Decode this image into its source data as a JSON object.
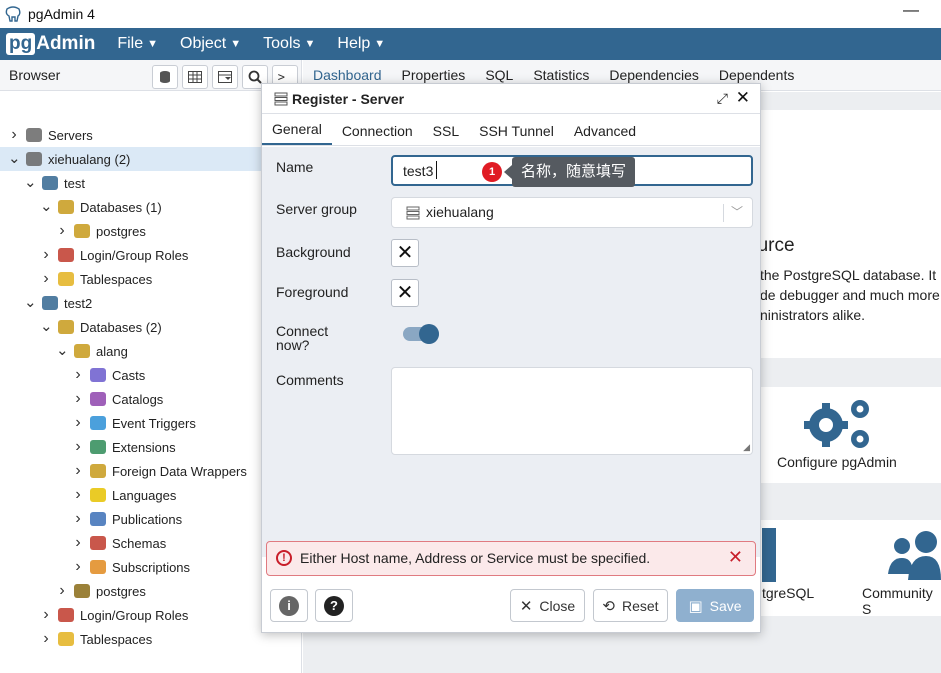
{
  "window": {
    "title": "pgAdmin 4",
    "minimize_glyph": "—"
  },
  "menubar": {
    "logo_pg": "pg",
    "logo_admin": "Admin",
    "items": [
      {
        "label": "File"
      },
      {
        "label": "Object"
      },
      {
        "label": "Tools"
      },
      {
        "label": "Help"
      }
    ]
  },
  "browser": {
    "title": "Browser",
    "tree": [
      {
        "label": "Servers",
        "icon": "servers-icon",
        "expanded": false
      },
      {
        "label": "xiehualang (2)",
        "icon": "server-group-icon",
        "expanded": true,
        "selected": true
      },
      {
        "label": "test",
        "icon": "postgres-server-icon",
        "expanded": true
      },
      {
        "label": "Databases (1)",
        "icon": "databases-icon",
        "expanded": true
      },
      {
        "label": "postgres",
        "icon": "database-icon",
        "expanded": false
      },
      {
        "label": "Login/Group Roles",
        "icon": "roles-icon",
        "expanded": false
      },
      {
        "label": "Tablespaces",
        "icon": "tablespaces-icon",
        "expanded": false
      },
      {
        "label": "test2",
        "icon": "postgres-server-icon",
        "expanded": true
      },
      {
        "label": "Databases (2)",
        "icon": "databases-icon",
        "expanded": true
      },
      {
        "label": "alang",
        "icon": "database-icon",
        "expanded": true
      },
      {
        "label": "Casts",
        "icon": "casts-icon",
        "expanded": false
      },
      {
        "label": "Catalogs",
        "icon": "catalogs-icon",
        "expanded": false
      },
      {
        "label": "Event Triggers",
        "icon": "event-triggers-icon",
        "expanded": false
      },
      {
        "label": "Extensions",
        "icon": "extensions-icon",
        "expanded": false
      },
      {
        "label": "Foreign Data Wrappers",
        "icon": "fdw-icon",
        "expanded": false
      },
      {
        "label": "Languages",
        "icon": "languages-icon",
        "expanded": false
      },
      {
        "label": "Publications",
        "icon": "publications-icon",
        "expanded": false
      },
      {
        "label": "Schemas",
        "icon": "schemas-icon",
        "expanded": false
      },
      {
        "label": "Subscriptions",
        "icon": "subscriptions-icon",
        "expanded": false
      },
      {
        "label": "postgres",
        "icon": "database-disconnected-icon",
        "expanded": false
      },
      {
        "label": "Login/Group Roles",
        "icon": "roles-icon",
        "expanded": false
      },
      {
        "label": "Tablespaces",
        "icon": "tablespaces-icon",
        "expanded": false
      }
    ]
  },
  "main": {
    "tabs": [
      "Dashboard",
      "Properties",
      "SQL",
      "Statistics",
      "Dependencies",
      "Dependents"
    ],
    "welcome_heading_fragment": "ource",
    "welcome_lines": [
      "the PostgreSQL database. It",
      "de debugger and much more",
      "ninistrators alike."
    ],
    "configure_label": "Configure pgAdmin",
    "postgresql_label": "tgreSQL",
    "community_label": "Community S"
  },
  "dialog": {
    "title": "Register - Server",
    "tabs": [
      "General",
      "Connection",
      "SSL",
      "SSH Tunnel",
      "Advanced"
    ],
    "fields": {
      "name_label": "Name",
      "name_value": "test3",
      "server_group_label": "Server group",
      "server_group_value": "xiehualang",
      "background_label": "Background",
      "foreground_label": "Foreground",
      "connect_now_label_1": "Connect",
      "connect_now_label_2": "now?",
      "comments_label": "Comments",
      "connect_now": true
    },
    "annotation": {
      "badge": "1",
      "tooltip": "名称，随意填写"
    },
    "error": "Either Host name, Address or Service must be specified.",
    "buttons": {
      "close": "Close",
      "reset": "Reset",
      "save": "Save"
    }
  },
  "colors": {
    "brand": "#326690",
    "error": "#c81e2a",
    "selected_row": "#dbe9f6"
  }
}
